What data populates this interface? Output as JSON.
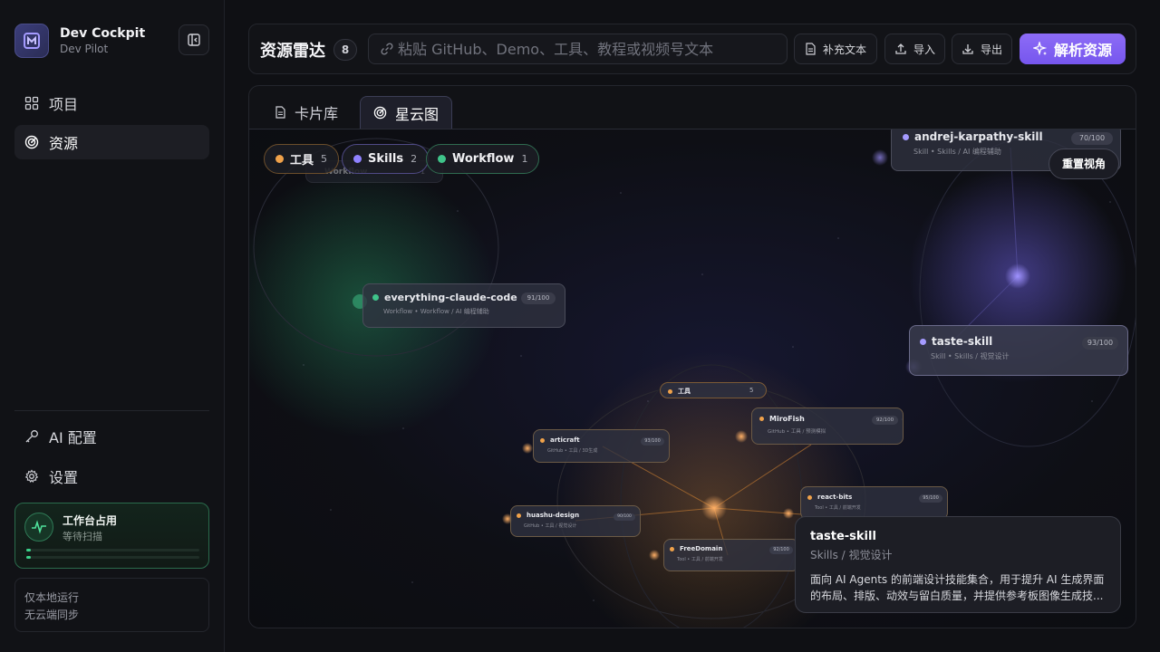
{
  "brand": {
    "title": "Dev Cockpit",
    "subtitle": "Dev Pilot"
  },
  "sidebar": {
    "items": [
      {
        "label": "项目",
        "icon": "grid-icon"
      },
      {
        "label": "资源",
        "icon": "radar-icon"
      }
    ],
    "bottom_items": [
      {
        "label": "AI 配置",
        "icon": "key-icon"
      },
      {
        "label": "设置",
        "icon": "gear-icon"
      }
    ],
    "status": {
      "title": "工作台占用",
      "subtitle": "等待扫描",
      "accent": "#3bd18a",
      "progress": [
        0.02,
        0.02
      ]
    },
    "local_note": [
      "仅本地运行",
      "无云端同步"
    ]
  },
  "header": {
    "title": "资源雷达",
    "count": "8",
    "search_placeholder": "粘贴 GitHub、Demo、工具、教程或视频号文本",
    "buttons": {
      "supplement": "补充文本",
      "import": "导入",
      "export": "导出",
      "parse": "解析资源"
    },
    "primary_color": "#7c5cf0"
  },
  "tabs": [
    {
      "label": "卡片库",
      "icon": "document-icon"
    },
    {
      "label": "星云图",
      "icon": "radar-icon",
      "active": true
    }
  ],
  "legend": [
    {
      "label": "工具",
      "count": "5",
      "color": "#f0a24a"
    },
    {
      "label": "Skills",
      "count": "2",
      "color": "#8f82ff"
    },
    {
      "label": "Workflow",
      "count": "1",
      "color": "#3fc48a"
    }
  ],
  "ghost_node": {
    "title": "Workflow",
    "count": "1"
  },
  "reset_label": "重置视角",
  "nodes": {
    "karpathy": {
      "title": "andrej-karpathy-skill",
      "subtitle": "Skill • Skills / AI 编程辅助",
      "score": "70/100",
      "color": "#a59bff"
    },
    "everything": {
      "title": "everything-claude-code",
      "subtitle": "Workflow • Workflow / AI 编程辅助",
      "score": "91/100",
      "color": "#3fc48a"
    },
    "taste": {
      "title": "taste-skill",
      "subtitle": "Skill • Skills / 视觉设计",
      "score": "93/100",
      "color": "#a59bff"
    },
    "tool_hub": {
      "title": "工具",
      "count": "5",
      "color": "#f0a24a"
    },
    "mirofish": {
      "title": "MiroFish",
      "subtitle": "GitHub • 工具 / 预测模拟",
      "score": "92/100",
      "color": "#f0a24a"
    },
    "articraft": {
      "title": "articraft",
      "subtitle": "GitHub • 工具 / 3D生成",
      "score": "93/100",
      "color": "#f0a24a"
    },
    "reactbits": {
      "title": "react-bits",
      "subtitle": "Tool • 工具 / 前端开发",
      "score": "95/100",
      "color": "#f0a24a"
    },
    "huashu": {
      "title": "huashu-design",
      "subtitle": "GitHub • 工具 / 视觉设计",
      "score": "90/100",
      "color": "#f0a24a"
    },
    "freedomain": {
      "title": "FreeDomain",
      "subtitle": "Tool • 工具 / 前端开发",
      "score": "92/100",
      "color": "#f0a24a"
    }
  },
  "tooltip": {
    "title": "taste-skill",
    "subtitle": "Skills / 视觉设计",
    "desc_line1": "面向 AI Agents 的前端设计技能集合，用于提升 AI 生成界面",
    "desc_line2": "的布局、排版、动效与留白质量，并提供参考板图像生成技..."
  }
}
